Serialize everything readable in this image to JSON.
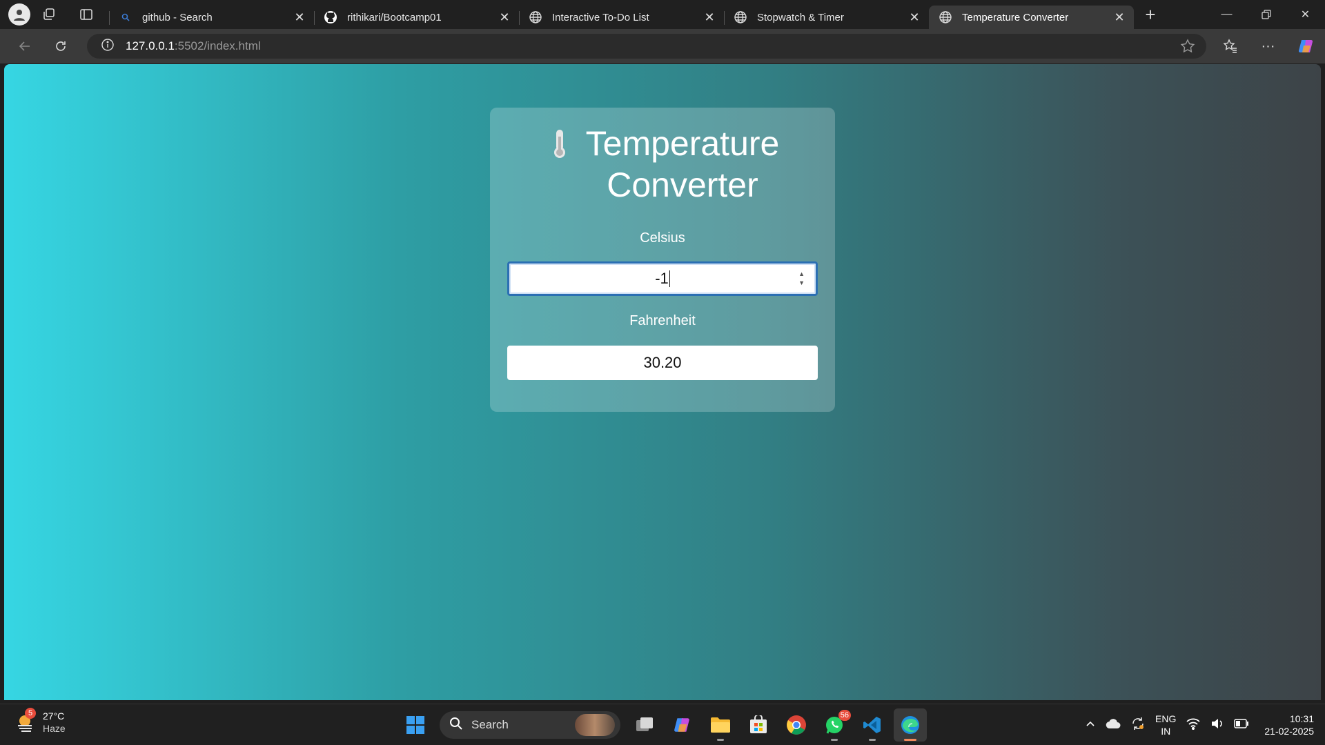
{
  "browser": {
    "tabs": [
      {
        "title": "github - Search",
        "favicon": "search-icon",
        "active": false
      },
      {
        "title": "rithikari/Bootcamp01",
        "favicon": "github-icon",
        "active": false
      },
      {
        "title": "Interactive To-Do List",
        "favicon": "globe-icon",
        "active": false
      },
      {
        "title": "Stopwatch & Timer",
        "favicon": "globe-icon",
        "active": false
      },
      {
        "title": "Temperature Converter",
        "favicon": "globe-icon",
        "active": true
      }
    ],
    "url_host": "127.0.0.1",
    "url_rest": ":5502/index.html"
  },
  "page": {
    "title_line1": "Temperature",
    "title_line2": "Converter",
    "title_icon": "thermometer-icon",
    "celsius_label": "Celsius",
    "celsius_value": "-1",
    "fahrenheit_label": "Fahrenheit",
    "fahrenheit_value": "30.20"
  },
  "taskbar": {
    "weather_temp": "27°C",
    "weather_cond": "Haze",
    "weather_badge": "5",
    "search_label": "Search",
    "whatsapp_badge": "56",
    "lang_line1": "ENG",
    "lang_line2": "IN",
    "time": "10:31",
    "date": "21-02-2025"
  }
}
